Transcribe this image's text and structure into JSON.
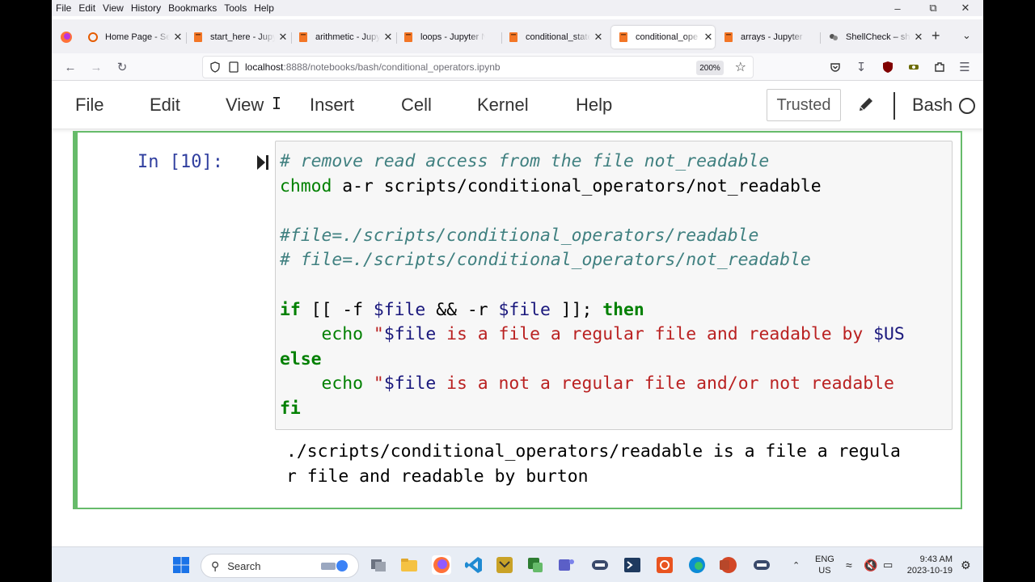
{
  "browser_menu": [
    "File",
    "Edit",
    "View",
    "History",
    "Bookmarks",
    "Tools",
    "Help"
  ],
  "tabs": [
    {
      "label": "Home Page - Se",
      "active": false
    },
    {
      "label": "start_here - Jupy",
      "active": false
    },
    {
      "label": "arithmetic - Jupy",
      "active": false
    },
    {
      "label": "loops - Jupyter N",
      "active": false
    },
    {
      "label": "conditional_state",
      "active": false
    },
    {
      "label": "conditional_ope",
      "active": true
    },
    {
      "label": "arrays - Jupyter N",
      "active": false
    },
    {
      "label": "ShellCheck – she",
      "active": false
    }
  ],
  "url": {
    "host": "localhost",
    "path": ":8888/notebooks/bash/conditional_operators.ipynb"
  },
  "zoom": "200%",
  "jupyter_menu": [
    "File",
    "Edit",
    "View",
    "Insert",
    "Cell",
    "Kernel",
    "Help"
  ],
  "trusted_label": "Trusted",
  "kernel_name": "Bash",
  "cell": {
    "prompt": "In [10]:",
    "output_lines": [
      "./scripts/conditional_operators/readable is a file a regula",
      "r file and readable by burton"
    ]
  },
  "taskbar": {
    "search_label": "Search",
    "lang_top": "ENG",
    "lang_bottom": "US",
    "time": "9:43 AM",
    "date": "2023-10-19"
  },
  "colors": {
    "cell_border": "#66bb6a",
    "prompt": "#303f9f",
    "comment": "#408080",
    "keyword": "#008000",
    "variable": "#19177c",
    "string": "#ba2121"
  }
}
